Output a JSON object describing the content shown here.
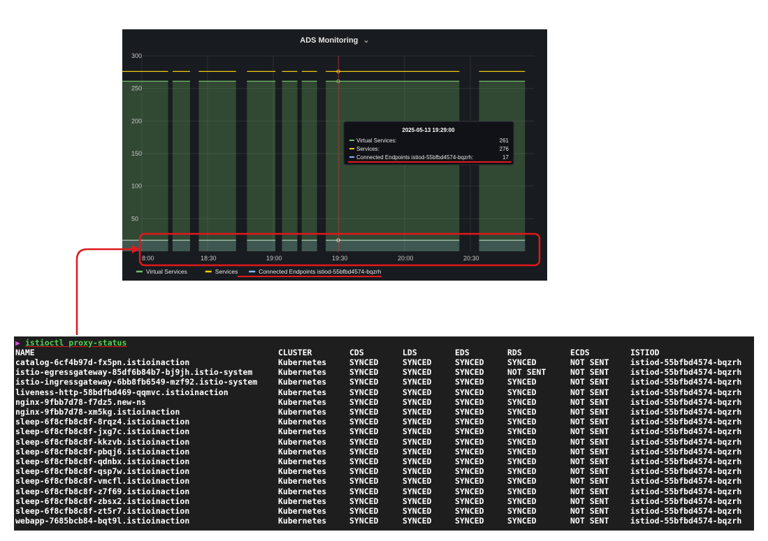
{
  "panel": {
    "title": "ADS Monitoring",
    "title_chevron": "⌄",
    "y_ticks": [
      "300",
      "250",
      "200",
      "150",
      "100",
      "50"
    ],
    "x_ticks": [
      "8:00",
      "18:30",
      "19:00",
      "19:30",
      "20:00",
      "20:30"
    ],
    "legend": [
      {
        "name": "Virtual Services",
        "color": "#73bf69"
      },
      {
        "name": "Services",
        "color": "#f2cc0c"
      },
      {
        "name": "Connected Endpoints istiod-55bfbd4574-bqzrh",
        "color": "#8ab8ff"
      }
    ],
    "tooltip": {
      "time": "2025-05-13 19:29:00",
      "rows": [
        {
          "label": "Virtual Services:",
          "value": "261",
          "color": "#73bf69"
        },
        {
          "label": "Services:",
          "value": "276",
          "color": "#f2cc0c"
        },
        {
          "label": "Connected Endpoints istiod-55bfbd4574-bqzrh:",
          "value": "17",
          "color": "#8ab8ff"
        }
      ]
    },
    "annotation_color": "#e0181b"
  },
  "chart_data": {
    "type": "area",
    "title": "ADS Monitoring",
    "x_ticks": [
      "8:00",
      "18:30",
      "19:00",
      "19:30",
      "20:00",
      "20:30"
    ],
    "ylim": [
      0,
      300
    ],
    "grid": true,
    "legend_position": "bottom-left",
    "series": [
      {
        "name": "Virtual Services",
        "values": [
          261,
          261,
          261,
          261,
          261,
          261,
          261,
          261,
          261,
          261
        ],
        "color": "#73bf69"
      },
      {
        "name": "Services",
        "values": [
          276,
          276,
          276,
          276,
          276,
          276,
          276,
          276,
          276,
          277
        ],
        "color": "#f2cc0c"
      },
      {
        "name": "Connected Endpoints istiod-55bfbd4574-bqzrh",
        "values": [
          17,
          17,
          17,
          17,
          17,
          17,
          17,
          17,
          17,
          17
        ],
        "color": "#8ab8ff"
      }
    ],
    "segments": [
      [
        "8:00",
        "18:12"
      ],
      [
        "18:14",
        "18:22"
      ],
      [
        "18:26",
        "18:43"
      ],
      [
        "18:48",
        "19:01"
      ],
      [
        "19:04",
        "19:11"
      ],
      [
        "19:13",
        "19:20"
      ],
      [
        "19:24",
        "20:25"
      ],
      [
        "20:34",
        "20:55"
      ]
    ]
  },
  "terminal": {
    "prompt": "▶",
    "command": "istioctl proxy-status",
    "headers": [
      "NAME",
      "CLUSTER",
      "CDS",
      "LDS",
      "EDS",
      "RDS",
      "ECDS",
      "ISTIOD"
    ],
    "rows": [
      [
        "catalog-6cf4b97d-fx5pn.istioinaction",
        "Kubernetes",
        "SYNCED",
        "SYNCED",
        "SYNCED",
        "SYNCED",
        "NOT SENT",
        "istiod-55bfbd4574-bqzrh"
      ],
      [
        "istio-egressgateway-85df6b84b7-bj9jh.istio-system",
        "Kubernetes",
        "SYNCED",
        "SYNCED",
        "SYNCED",
        "NOT SENT",
        "NOT SENT",
        "istiod-55bfbd4574-bqzrh"
      ],
      [
        "istio-ingressgateway-6bb8fb6549-mzf92.istio-system",
        "Kubernetes",
        "SYNCED",
        "SYNCED",
        "SYNCED",
        "SYNCED",
        "NOT SENT",
        "istiod-55bfbd4574-bqzrh"
      ],
      [
        "liveness-http-58bdfbd469-qqmvc.istioinaction",
        "Kubernetes",
        "SYNCED",
        "SYNCED",
        "SYNCED",
        "SYNCED",
        "NOT SENT",
        "istiod-55bfbd4574-bqzrh"
      ],
      [
        "nginx-9fbb7d78-f7dz5.new-ns",
        "Kubernetes",
        "SYNCED",
        "SYNCED",
        "SYNCED",
        "SYNCED",
        "NOT SENT",
        "istiod-55bfbd4574-bqzrh"
      ],
      [
        "nginx-9fbb7d78-xm5kg.istioinaction",
        "Kubernetes",
        "SYNCED",
        "SYNCED",
        "SYNCED",
        "SYNCED",
        "NOT SENT",
        "istiod-55bfbd4574-bqzrh"
      ],
      [
        "sleep-6f8cfb8c8f-8rqz4.istioinaction",
        "Kubernetes",
        "SYNCED",
        "SYNCED",
        "SYNCED",
        "SYNCED",
        "NOT SENT",
        "istiod-55bfbd4574-bqzrh"
      ],
      [
        "sleep-6f8cfb8c8f-jxg7c.istioinaction",
        "Kubernetes",
        "SYNCED",
        "SYNCED",
        "SYNCED",
        "SYNCED",
        "NOT SENT",
        "istiod-55bfbd4574-bqzrh"
      ],
      [
        "sleep-6f8cfb8c8f-kkzvb.istioinaction",
        "Kubernetes",
        "SYNCED",
        "SYNCED",
        "SYNCED",
        "SYNCED",
        "NOT SENT",
        "istiod-55bfbd4574-bqzrh"
      ],
      [
        "sleep-6f8cfb8c8f-pbqj6.istioinaction",
        "Kubernetes",
        "SYNCED",
        "SYNCED",
        "SYNCED",
        "SYNCED",
        "NOT SENT",
        "istiod-55bfbd4574-bqzrh"
      ],
      [
        "sleep-6f8cfb8c8f-qdnbx.istioinaction",
        "Kubernetes",
        "SYNCED",
        "SYNCED",
        "SYNCED",
        "SYNCED",
        "NOT SENT",
        "istiod-55bfbd4574-bqzrh"
      ],
      [
        "sleep-6f8cfb8c8f-qsp7w.istioinaction",
        "Kubernetes",
        "SYNCED",
        "SYNCED",
        "SYNCED",
        "SYNCED",
        "NOT SENT",
        "istiod-55bfbd4574-bqzrh"
      ],
      [
        "sleep-6f8cfb8c8f-vmcfl.istioinaction",
        "Kubernetes",
        "SYNCED",
        "SYNCED",
        "SYNCED",
        "SYNCED",
        "NOT SENT",
        "istiod-55bfbd4574-bqzrh"
      ],
      [
        "sleep-6f8cfb8c8f-z7f69.istioinaction",
        "Kubernetes",
        "SYNCED",
        "SYNCED",
        "SYNCED",
        "SYNCED",
        "NOT SENT",
        "istiod-55bfbd4574-bqzrh"
      ],
      [
        "sleep-6f8cfb8c8f-zbsx2.istioinaction",
        "Kubernetes",
        "SYNCED",
        "SYNCED",
        "SYNCED",
        "SYNCED",
        "NOT SENT",
        "istiod-55bfbd4574-bqzrh"
      ],
      [
        "sleep-6f8cfb8c8f-zt5r7.istioinaction",
        "Kubernetes",
        "SYNCED",
        "SYNCED",
        "SYNCED",
        "SYNCED",
        "NOT SENT",
        "istiod-55bfbd4574-bqzrh"
      ],
      [
        "webapp-7685bcb84-bqt9l.istioinaction",
        "Kubernetes",
        "SYNCED",
        "SYNCED",
        "SYNCED",
        "SYNCED",
        "NOT SENT",
        "istiod-55bfbd4574-bqzrh"
      ]
    ]
  }
}
